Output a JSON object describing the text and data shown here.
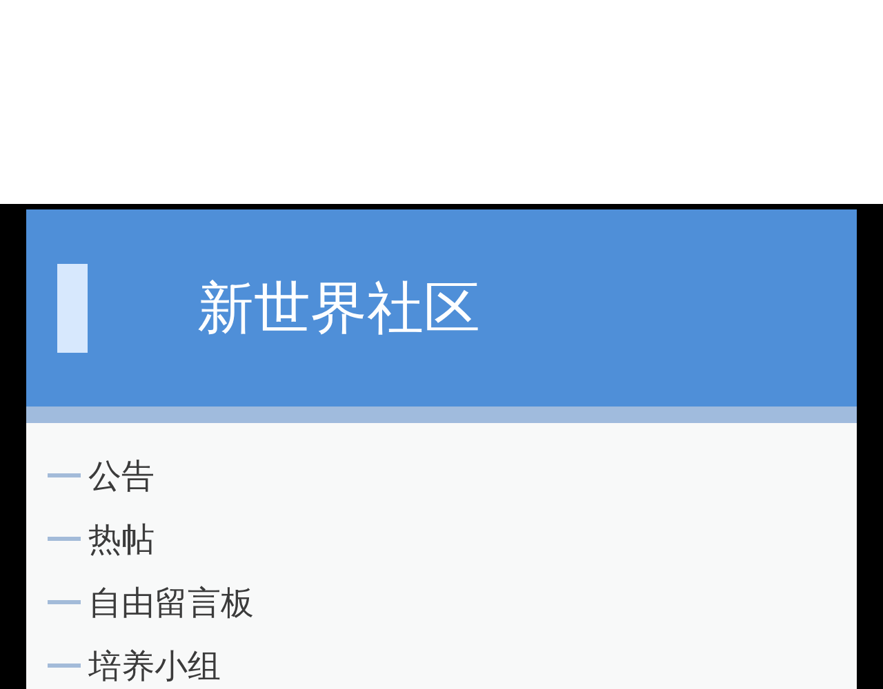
{
  "header": {
    "title": "新世界社区"
  },
  "menu": {
    "items": [
      {
        "label": "公告"
      },
      {
        "label": "热帖"
      },
      {
        "label": "自由留言板"
      },
      {
        "label": "培养小组"
      }
    ]
  }
}
